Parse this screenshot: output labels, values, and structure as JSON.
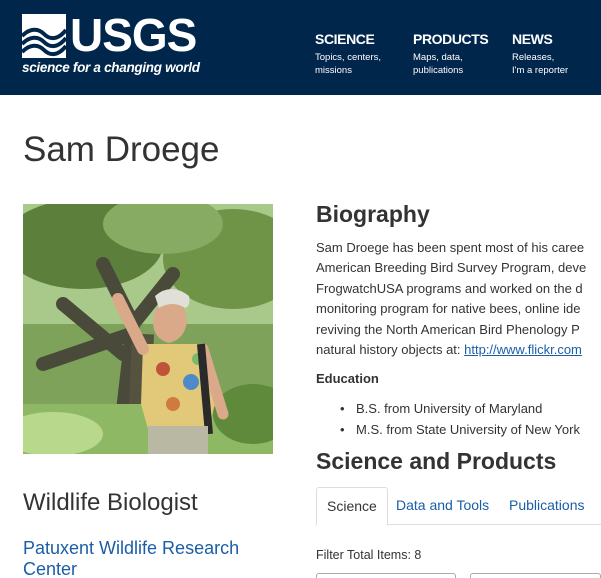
{
  "header": {
    "logo_text": "USGS",
    "tagline": "science for a changing world",
    "nav": [
      {
        "title": "SCIENCE",
        "sub1": "Topics, centers,",
        "sub2": "missions"
      },
      {
        "title": "PRODUCTS",
        "sub1": "Maps, data,",
        "sub2": "publications"
      },
      {
        "title": "NEWS",
        "sub1": "Releases,",
        "sub2": "I'm a reporter"
      }
    ],
    "colors": {
      "background": "#00264c",
      "text": "#ffffff"
    }
  },
  "profile": {
    "name": "Sam Droege",
    "job_title": "Wildlife Biologist",
    "organization": "Patuxent Wildlife Research Center"
  },
  "biography": {
    "heading": "Biography",
    "lines": [
      "Sam Droege has been spent most of his caree",
      "American Breeding Bird Survey Program, deve",
      "FrogwatchUSA programs and worked on the d",
      "monitoring program for native bees, online ide",
      "reviving the North American Bird Phenology P"
    ],
    "last_line_prefix": "natural history objects at: ",
    "link_text": "http://www.flickr.com",
    "education_heading": "Education",
    "education": [
      "B.S. from University of Maryland",
      "M.S. from State University of New York"
    ]
  },
  "science_products": {
    "heading": "Science and Products",
    "tabs": [
      "Science",
      "Data and Tools",
      "Publications"
    ],
    "active_tab": "Science",
    "filter_label": "Filter Total Items: 8"
  },
  "colors": {
    "link": "#1a5ea8",
    "text": "#333333"
  }
}
